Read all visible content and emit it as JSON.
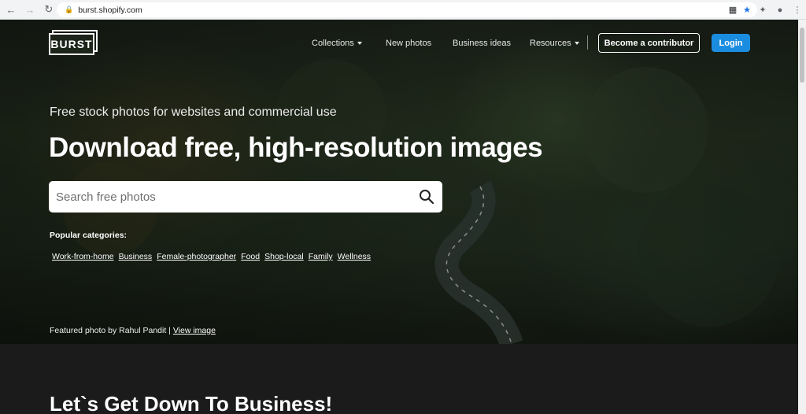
{
  "browser": {
    "url": "burst.shopify.com"
  },
  "nav": {
    "logo_text": "BURST",
    "items": [
      {
        "label": "Collections",
        "dropdown": true
      },
      {
        "label": "New photos",
        "dropdown": false
      },
      {
        "label": "Business ideas",
        "dropdown": false
      },
      {
        "label": "Resources",
        "dropdown": true
      }
    ],
    "contributor_label": "Become a contributor",
    "login_label": "Login"
  },
  "hero": {
    "tagline": "Free stock photos for websites and commercial use",
    "headline": "Download free, high-resolution images",
    "search_placeholder": "Search free photos",
    "popular_label": "Popular categories:",
    "categories": [
      "Work-from-home",
      "Business",
      "Female-photographer",
      "Food",
      "Shop-local",
      "Family",
      "Wellness"
    ],
    "featured_text": "Featured photo by Rahul Pandit | ",
    "featured_link": "View image"
  },
  "section2": {
    "heading": "Let`s Get Down To Business!"
  },
  "colors": {
    "login_button": "#1b8de0",
    "bookmark_star": "#1a73e8"
  }
}
